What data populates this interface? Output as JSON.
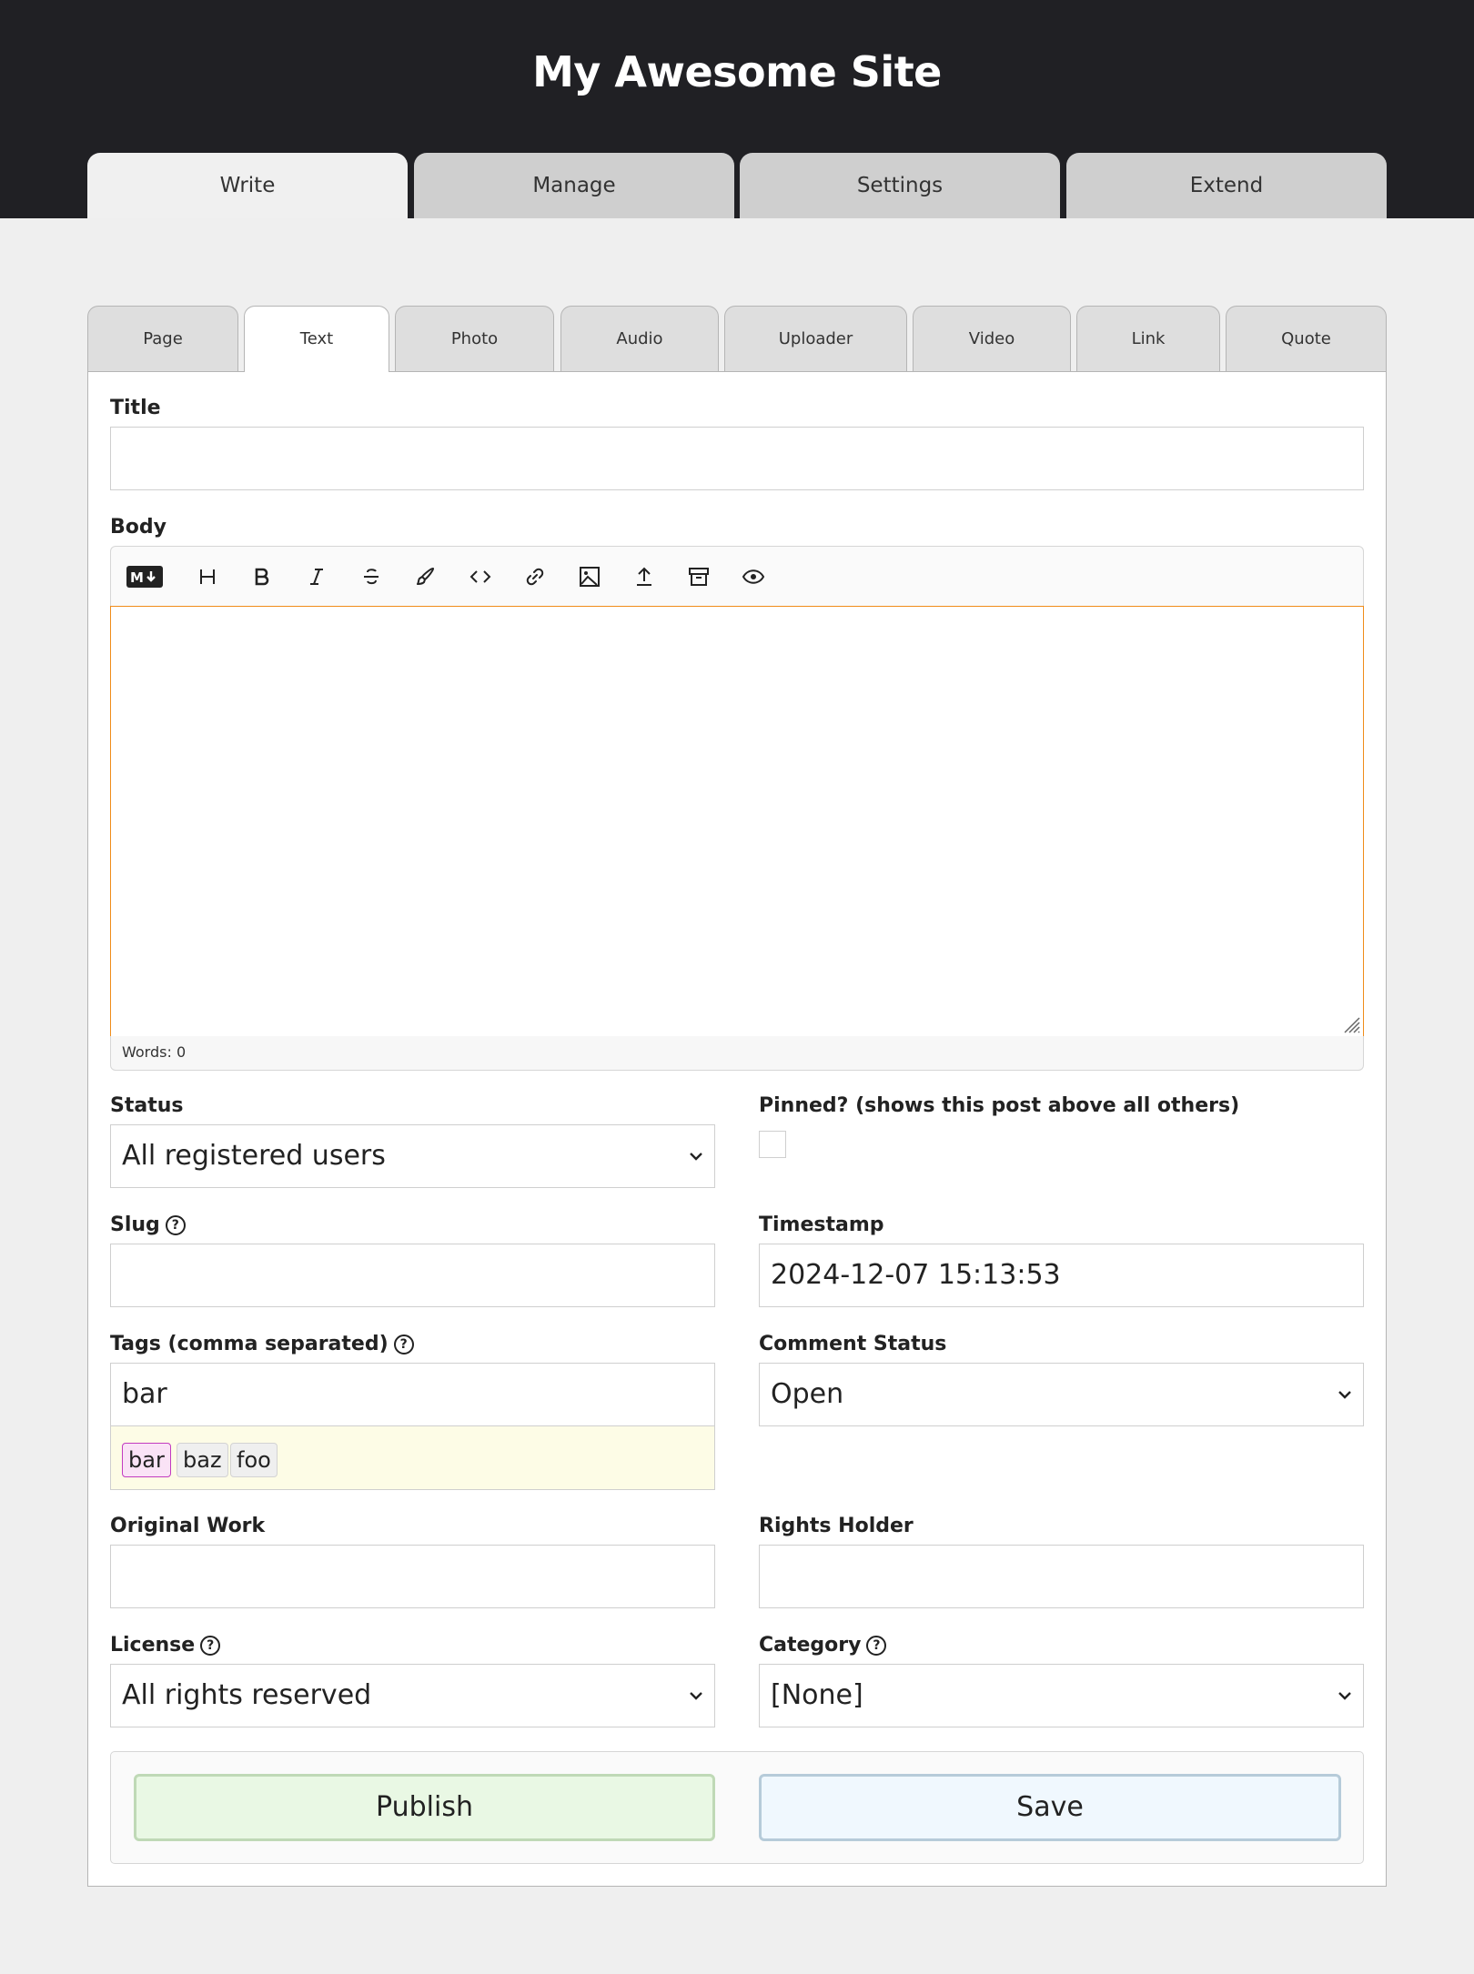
{
  "site": {
    "title": "My Awesome Site"
  },
  "main_tabs": [
    {
      "label": "Write",
      "active": true
    },
    {
      "label": "Manage",
      "active": false
    },
    {
      "label": "Settings",
      "active": false
    },
    {
      "label": "Extend",
      "active": false
    }
  ],
  "sub_tabs": [
    {
      "label": "Page",
      "active": false
    },
    {
      "label": "Text",
      "active": true
    },
    {
      "label": "Photo",
      "active": false
    },
    {
      "label": "Audio",
      "active": false
    },
    {
      "label": "Uploader",
      "active": false
    },
    {
      "label": "Video",
      "active": false
    },
    {
      "label": "Link",
      "active": false
    },
    {
      "label": "Quote",
      "active": false
    }
  ],
  "form": {
    "title": {
      "label": "Title",
      "value": ""
    },
    "body": {
      "label": "Body",
      "toolbar": [
        {
          "icon": "markdown-icon",
          "title": "Markdown"
        },
        {
          "icon": "heading-icon",
          "title": "Heading"
        },
        {
          "icon": "bold-icon",
          "title": "Bold"
        },
        {
          "icon": "italic-icon",
          "title": "Italic"
        },
        {
          "icon": "strikethrough-icon",
          "title": "Strikethrough"
        },
        {
          "icon": "highlight-brush-icon",
          "title": "Highlight"
        },
        {
          "icon": "code-icon",
          "title": "Code"
        },
        {
          "icon": "link-icon",
          "title": "Link"
        },
        {
          "icon": "image-icon",
          "title": "Image"
        },
        {
          "icon": "upload-icon",
          "title": "Upload"
        },
        {
          "icon": "archive-icon",
          "title": "Archive"
        },
        {
          "icon": "preview-eye-icon",
          "title": "Preview"
        }
      ],
      "value": "",
      "word_count": "Words: 0"
    },
    "status": {
      "label": "Status",
      "value": "All registered users"
    },
    "pinned": {
      "label": "Pinned? (shows this post above all others)",
      "checked": false
    },
    "slug": {
      "label": "Slug",
      "value": ""
    },
    "timestamp": {
      "label": "Timestamp",
      "value": "2024-12-07 15:13:53"
    },
    "tags": {
      "label": "Tags (comma separated)",
      "value": "bar",
      "suggestions": [
        {
          "label": "bar",
          "selected": true
        },
        {
          "label": "baz",
          "selected": false
        },
        {
          "label": "foo",
          "selected": false
        }
      ]
    },
    "comment_status": {
      "label": "Comment Status",
      "value": "Open"
    },
    "original_work": {
      "label": "Original Work",
      "value": ""
    },
    "rights_holder": {
      "label": "Rights Holder",
      "value": ""
    },
    "license": {
      "label": "License",
      "value": "All rights reserved"
    },
    "category": {
      "label": "Category",
      "value": "[None]"
    }
  },
  "actions": {
    "publish_label": "Publish",
    "save_label": "Save"
  },
  "colors": {
    "header_bg": "#202024",
    "editor_focus": "#f08c1a",
    "publish_bg": "#e9f8e4",
    "save_bg": "#f0f8fe",
    "tag_selected": "#c23bc0"
  }
}
